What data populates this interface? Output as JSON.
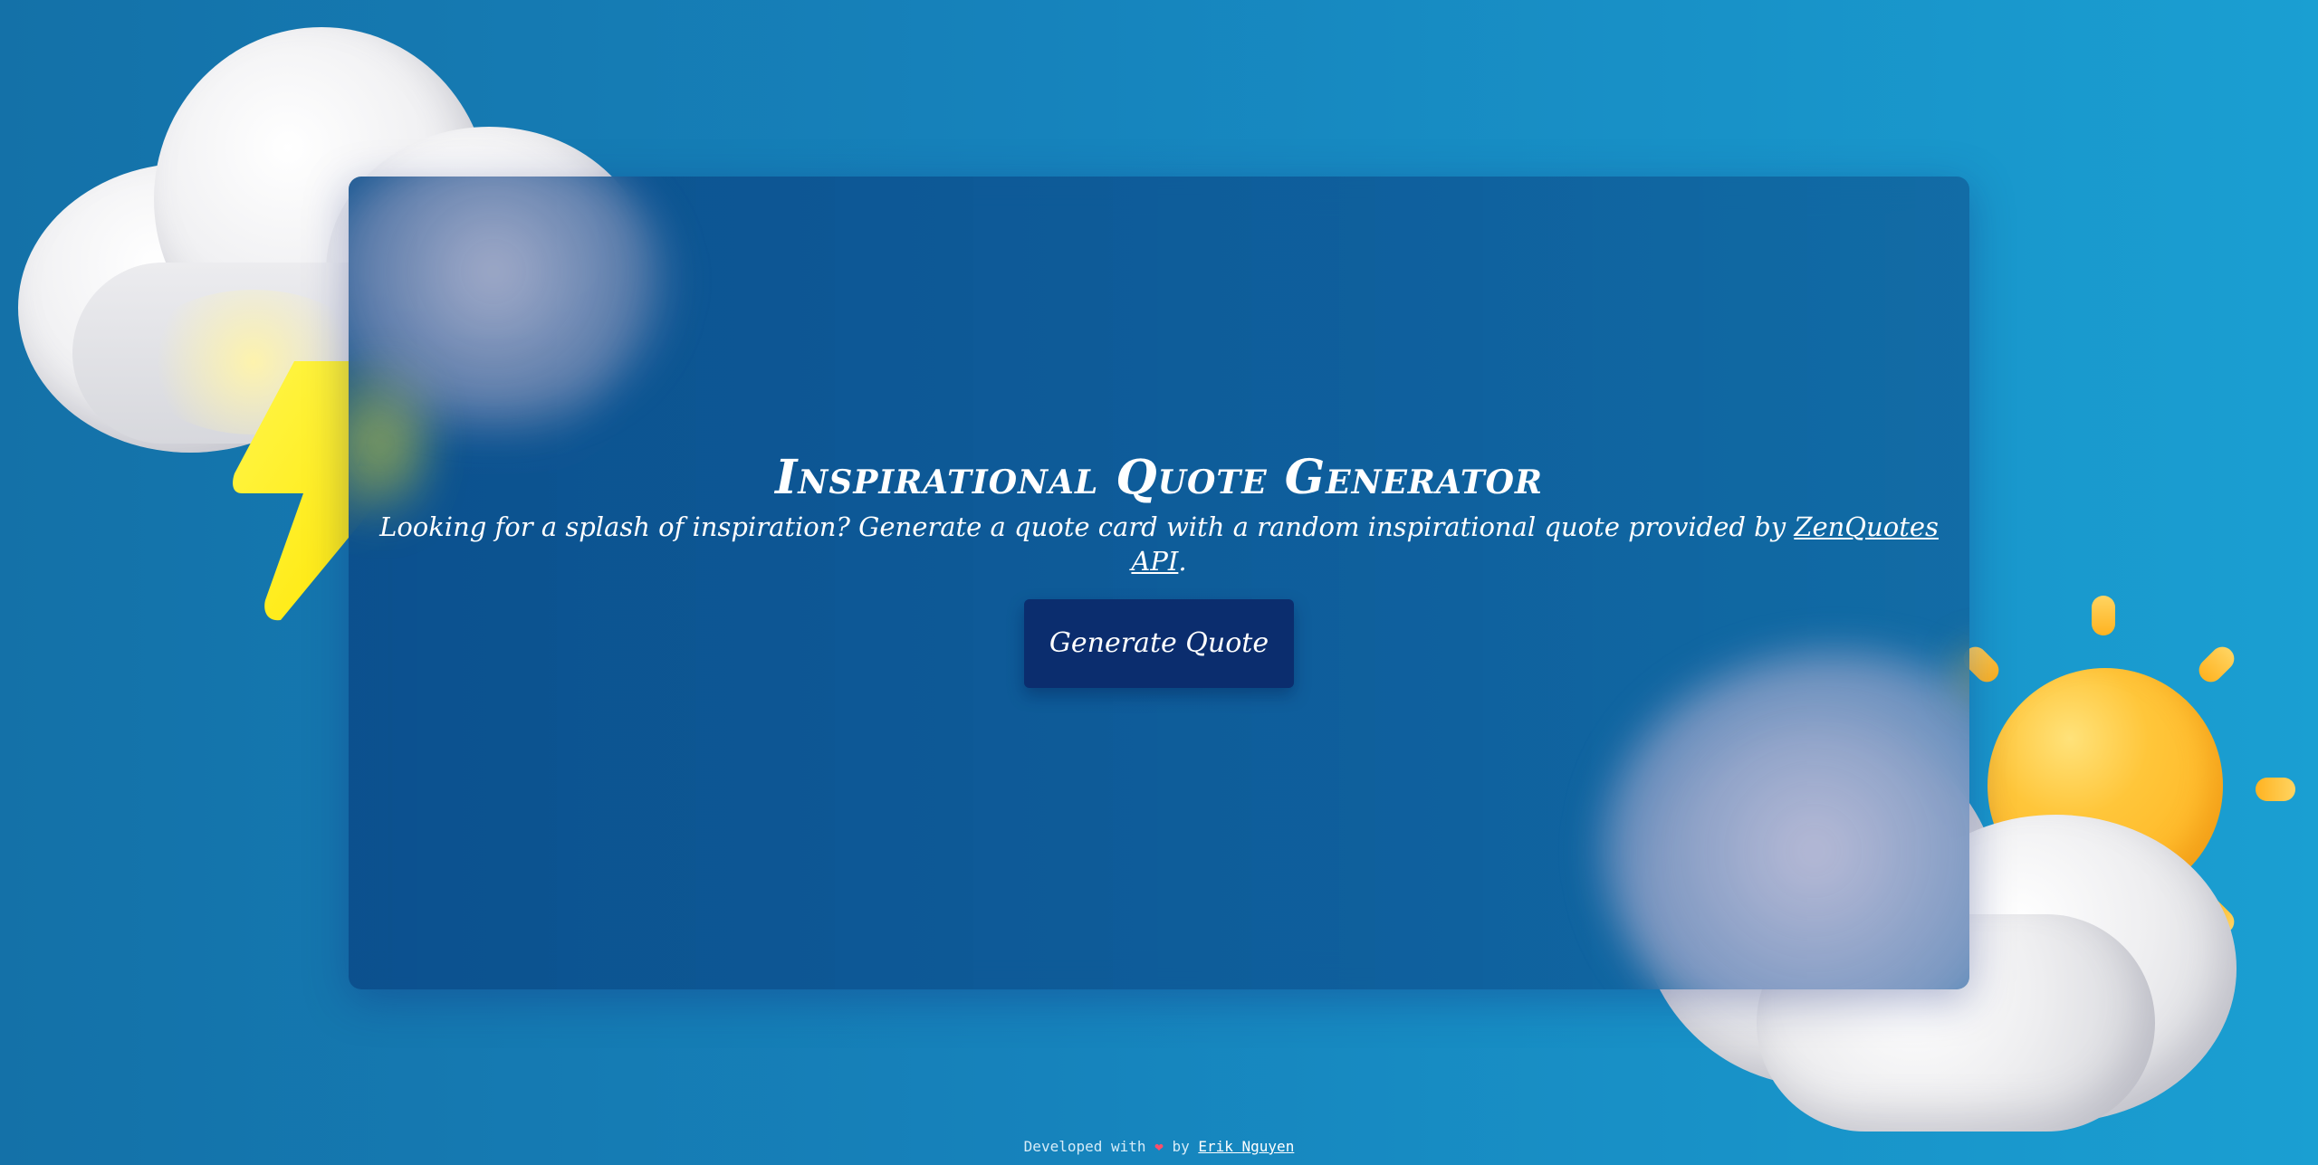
{
  "page": {
    "title": "Inspirational Quote Generator",
    "subtitle_prefix": "Looking for a splash of inspiration? Generate a quote card with a random inspirational quote provided by ",
    "subtitle_link": "ZenQuotes API",
    "subtitle_suffix": ".",
    "button_label": "Generate Quote"
  },
  "footer": {
    "prefix": "Developed with",
    "heart": "❤",
    "by": "by",
    "author": "Erik Nguyen"
  },
  "icons": {
    "storm_cloud": "storm-cloud-icon",
    "lightning": "lightning-bolt-icon",
    "sun": "sun-icon",
    "cloud": "cloud-icon",
    "heart": "heart-icon"
  },
  "colors": {
    "background_left": "#1471a8",
    "background_right": "#1a9fd2",
    "card": "#0e5a98",
    "button": "#0b2d6e",
    "sun": "#ffc63a",
    "lightning": "#ffef1a",
    "heart": "#ff4d6a"
  }
}
